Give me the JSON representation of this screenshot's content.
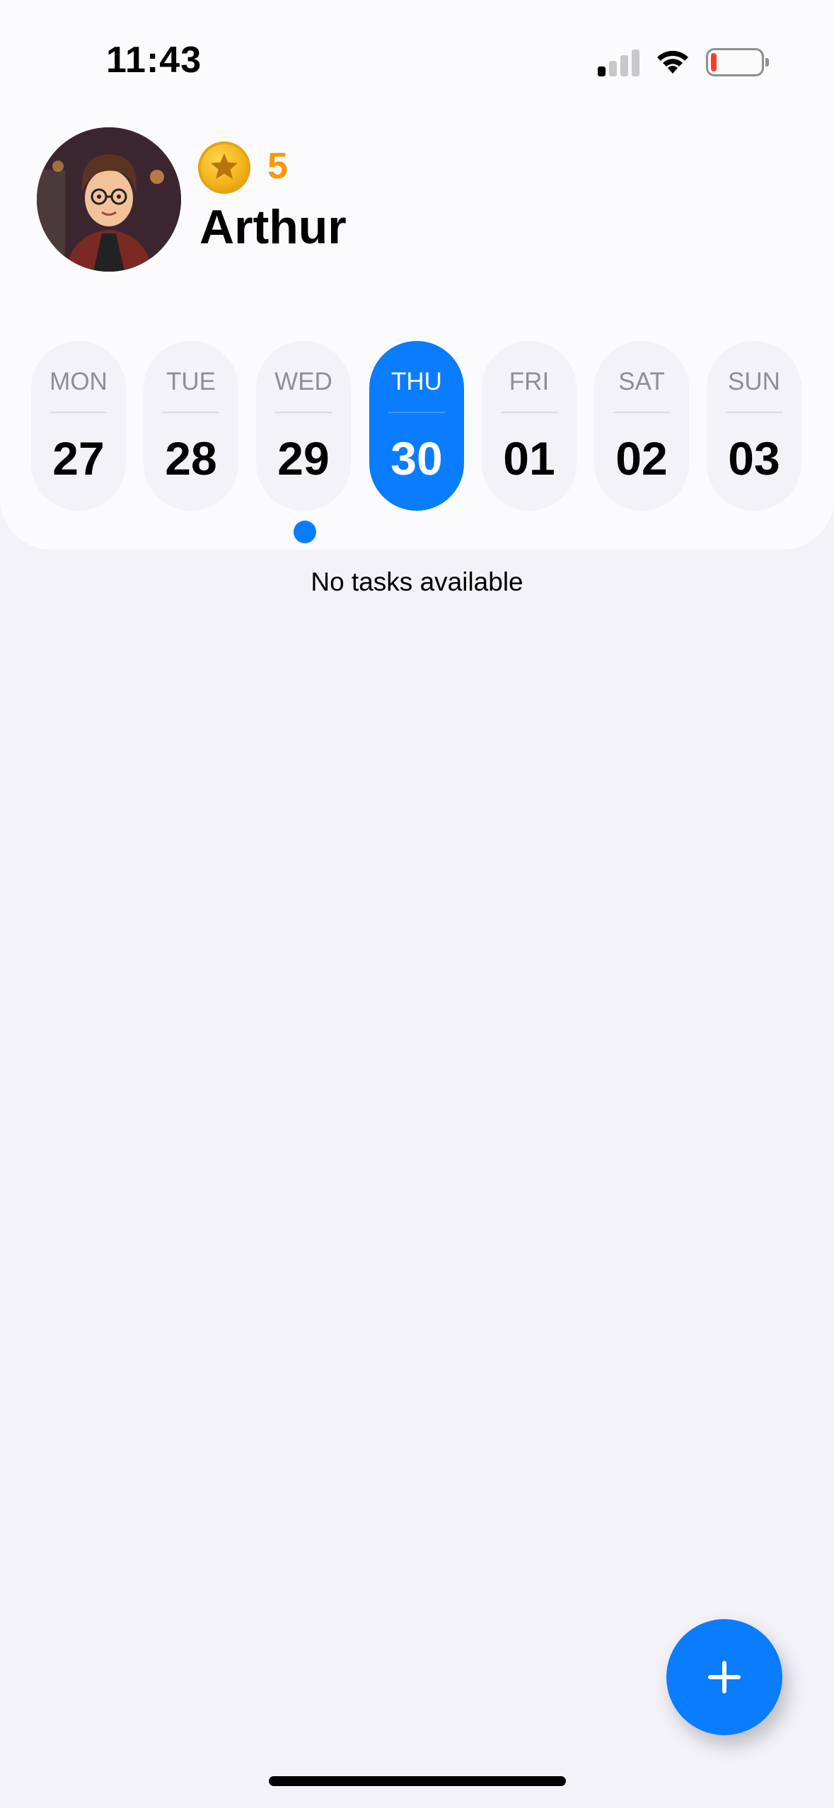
{
  "status_bar": {
    "time": "11:43",
    "signal_icon": "cellular-signal-icon",
    "wifi_icon": "wifi-icon",
    "battery_icon": "battery-low-icon",
    "battery_level": 0.12
  },
  "profile": {
    "name": "Arthur",
    "coins": "5",
    "coin_icon": "star-coin-icon",
    "avatar_icon": "avatar"
  },
  "week": {
    "days": [
      {
        "name": "MON",
        "num": "27"
      },
      {
        "name": "TUE",
        "num": "28"
      },
      {
        "name": "WED",
        "num": "29"
      },
      {
        "name": "THU",
        "num": "30"
      },
      {
        "name": "FRI",
        "num": "01"
      },
      {
        "name": "SAT",
        "num": "02"
      },
      {
        "name": "SUN",
        "num": "03"
      }
    ],
    "selected_day": "THU",
    "marked_day": "WED"
  },
  "tasks": {
    "empty_message": "No tasks available"
  },
  "fab": {
    "icon": "plus-icon"
  },
  "colors": {
    "accent": "#0a7cff",
    "coins": "#ff9500",
    "background": "#f2f2f7",
    "card": "#fbfbfd"
  }
}
